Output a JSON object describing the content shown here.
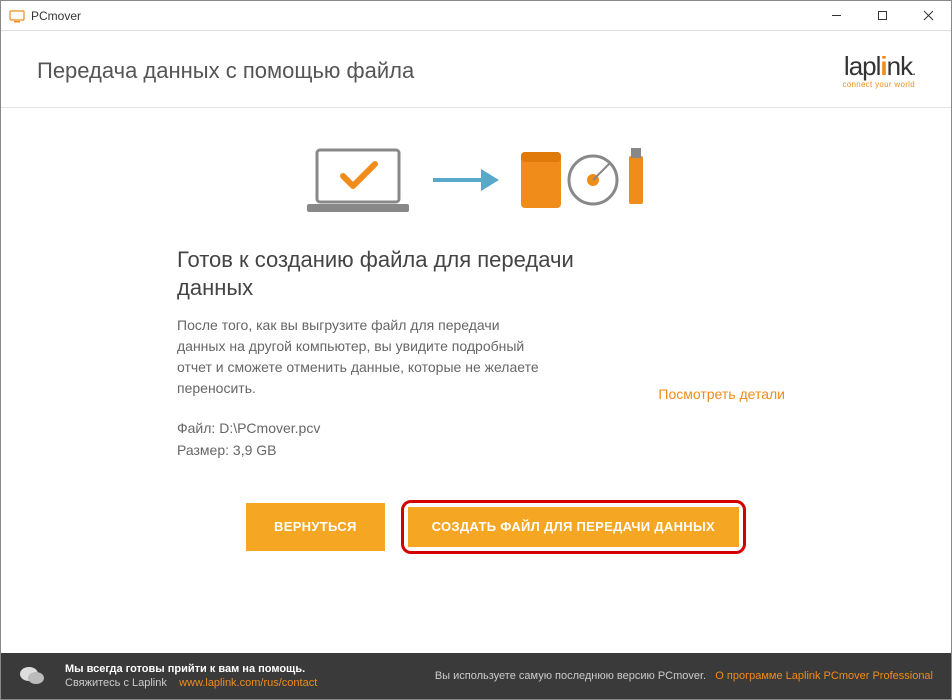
{
  "titlebar": {
    "app_name": "PCmover"
  },
  "header": {
    "page_title": "Передача данных с помощью файла",
    "logo_text": "laplink",
    "logo_sub": "connect your world"
  },
  "main": {
    "heading": "Готов к созданию файла для передачи данных",
    "description": "После того, как вы выгрузите файл для передачи данных на другой компьютер, вы увидите подробный отчет и сможете отменить данные, которые не желаете переносить.",
    "file_label": "Файл:",
    "file_path": "D:\\PCmover.pcv",
    "size_label": "Размер:",
    "size_value": "3,9 GB",
    "details_link": "Посмотреть детали"
  },
  "buttons": {
    "back": "ВЕРНУТЬСЯ",
    "create": "СОЗДАТЬ ФАЙЛ ДЛЯ ПЕРЕДАЧИ ДАННЫХ"
  },
  "footer": {
    "help_bold": "Мы всегда готовы прийти к вам на помощь.",
    "contact_prefix": "Свяжитесь с Laplink",
    "contact_url": "www.laplink.com/rus/contact",
    "version_text": "Вы используете самую последнюю версию PCmover.",
    "about_link": "О программе Laplink PCmover Professional"
  }
}
